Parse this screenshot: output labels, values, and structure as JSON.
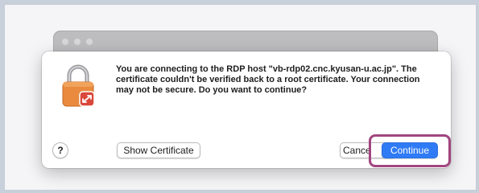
{
  "dialog": {
    "message": "You are connecting to the RDP host \"vb-rdp02.cnc.kyusan-u.ac.jp\". The certificate couldn't be verified back to a root certificate. Your connection may not be secure. Do you want to continue?",
    "help_label": "?",
    "show_certificate_label": "Show Certificate",
    "cancel_label": "Cance",
    "continue_label": "Continue"
  },
  "icons": {
    "lock": "padlock-icon",
    "app_badge": "remote-desktop-icon"
  },
  "colors": {
    "accent": "#2f7bf5",
    "highlight": "#a0467f",
    "lock_body": "#e98a3e",
    "badge": "#d9483b"
  }
}
